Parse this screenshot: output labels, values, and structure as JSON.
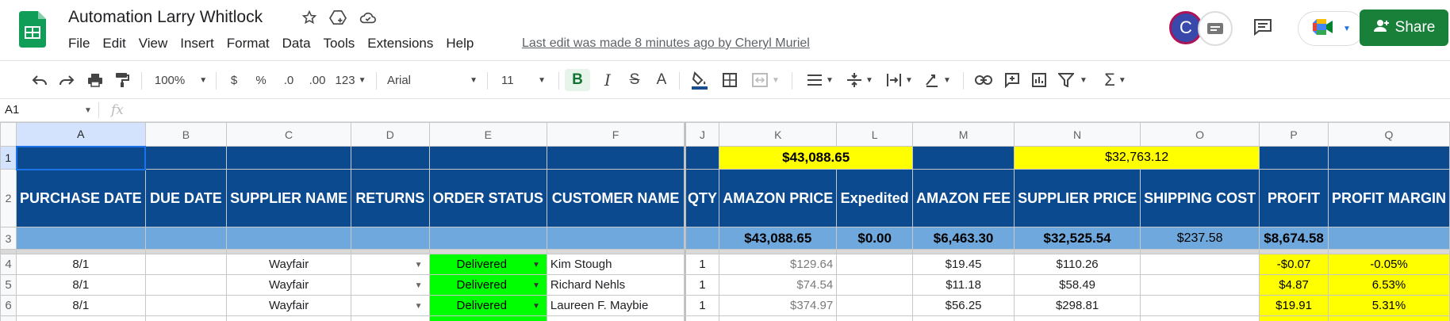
{
  "app": {
    "title": "Automation Larry Whitlock",
    "menu": [
      "File",
      "Edit",
      "View",
      "Insert",
      "Format",
      "Data",
      "Tools",
      "Extensions",
      "Help"
    ],
    "last_edit": "Last edit was made 8 minutes ago by Cheryl Muriel",
    "avatar_letter": "C",
    "share_label": "Share",
    "brand_color": "#188038"
  },
  "toolbar": {
    "zoom": "100%",
    "currency": "$",
    "percent": "%",
    "dec_decrease": ".0",
    "dec_increase": ".00",
    "format_more": "123",
    "font": "Arial",
    "font_size": "11",
    "bold": "B",
    "italic": "I",
    "strike": "S",
    "text_color": "A"
  },
  "formula_bar": {
    "cell_ref": "A1",
    "fx": "fx",
    "value": ""
  },
  "sheet": {
    "columns": [
      "A",
      "B",
      "C",
      "D",
      "E",
      "F",
      "J",
      "K",
      "L",
      "M",
      "N",
      "O",
      "P",
      "Q"
    ],
    "row_numbers": [
      "1",
      "2",
      "3",
      "4",
      "5",
      "6"
    ],
    "row1": {
      "K": "$43,088.65",
      "N": "$32,763.12"
    },
    "headers": {
      "A": "PURCHASE DATE",
      "B": "DUE DATE",
      "C": "SUPPLIER NAME",
      "D": "RETURNS",
      "E": "ORDER STATUS",
      "F": "CUSTOMER NAME",
      "J": "QTY",
      "K": "AMAZON PRICE",
      "L": "Expedited",
      "M": "AMAZON FEE",
      "N": "SUPPLIER PRICE",
      "O": "SHIPPING COST",
      "P": "PROFIT",
      "Q": "PROFIT MARGIN"
    },
    "totals": {
      "K": "$43,088.65",
      "L": "$0.00",
      "M": "$6,463.30",
      "N": "$32,525.54",
      "O": "$237.58",
      "P": "$8,674.58"
    },
    "rows": [
      {
        "A": "8/1",
        "C": "Wayfair",
        "E": "Delivered",
        "F": "Kim Stough",
        "J": "1",
        "K": "$129.64",
        "M": "$19.45",
        "N": "$110.26",
        "P": "-$0.07",
        "Q": "-0.05%"
      },
      {
        "A": "8/1",
        "C": "Wayfair",
        "E": "Delivered",
        "F": "Richard Nehls",
        "J": "1",
        "K": "$74.54",
        "M": "$11.18",
        "N": "$58.49",
        "P": "$4.87",
        "Q": "6.53%"
      },
      {
        "A": "8/1",
        "C": "Wayfair",
        "E": "Delivered",
        "F": "Laureen F. Maybie",
        "J": "1",
        "K": "$374.97",
        "M": "$56.25",
        "N": "$298.81",
        "P": "$19.91",
        "Q": "5.31%"
      }
    ],
    "colors": {
      "header_navy": "#0b4a8f",
      "totals_row": "#6fa8dc",
      "highlight_yellow": "#ffff00",
      "status_green": "#00ff00"
    }
  }
}
